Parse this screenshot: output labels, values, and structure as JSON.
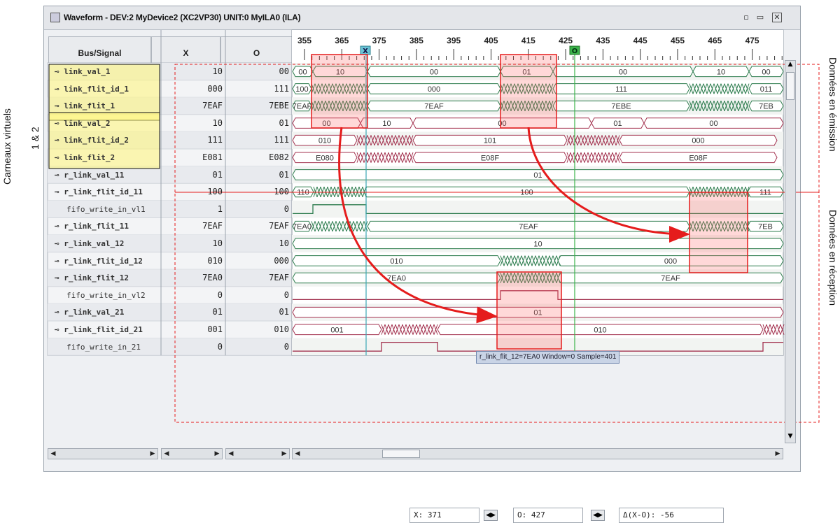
{
  "window": {
    "title": "Waveform - DEV:2 MyDevice2 (XC2VP30) UNIT:0 MyILA0 (ILA)"
  },
  "columns": {
    "bus_signal": "Bus/Signal",
    "x": "X",
    "o": "O"
  },
  "ruler": [
    "355",
    "365",
    "375",
    "385",
    "395",
    "405",
    "415",
    "425",
    "435",
    "445",
    "455",
    "465",
    "475"
  ],
  "cursors": {
    "x_label": "X",
    "o_label": "O"
  },
  "signals": [
    {
      "name": "link_val_1",
      "x": "10",
      "o": "00",
      "bold": true
    },
    {
      "name": "link_flit_id_1",
      "x": "000",
      "o": "111",
      "bold": true
    },
    {
      "name": "link_flit_1",
      "x": "7EAF",
      "o": "7EBE",
      "bold": true
    },
    {
      "name": "link_val_2",
      "x": "10",
      "o": "01",
      "bold": true
    },
    {
      "name": "link_flit_id_2",
      "x": "111",
      "o": "111",
      "bold": true
    },
    {
      "name": "link_flit_2",
      "x": "E081",
      "o": "E082",
      "bold": true
    },
    {
      "name": "r_link_val_11",
      "x": "01",
      "o": "01",
      "bold": true
    },
    {
      "name": "r_link_flit_id_11",
      "x": "100",
      "o": "100",
      "bold": true
    },
    {
      "name": "fifo_write_in_vl1",
      "x": "1",
      "o": "0",
      "bold": false
    },
    {
      "name": "r_link_flit_11",
      "x": "7EAF",
      "o": "7EAF",
      "bold": true
    },
    {
      "name": "r_link_val_12",
      "x": "10",
      "o": "10",
      "bold": true
    },
    {
      "name": "r_link_flit_id_12",
      "x": "010",
      "o": "000",
      "bold": true
    },
    {
      "name": "r_link_flit_12",
      "x": "7EA0",
      "o": "7EAF",
      "bold": true
    },
    {
      "name": "fifo_write_in_vl2",
      "x": "0",
      "o": "0",
      "bold": false
    },
    {
      "name": "r_link_val_21",
      "x": "01",
      "o": "01",
      "bold": true
    },
    {
      "name": "r_link_flit_id_21",
      "x": "001",
      "o": "010",
      "bold": true
    },
    {
      "name": "fifo_write_in_21",
      "x": "0",
      "o": "0",
      "bold": false
    }
  ],
  "wave_labels": {
    "r0": [
      "00",
      "10",
      "00",
      "01",
      "00",
      "10",
      "00"
    ],
    "r1": [
      "100",
      "000",
      "111",
      "011"
    ],
    "r2": [
      "7EAF",
      "7EAF",
      "7EBE",
      "7EB"
    ],
    "r3": [
      "00",
      "10",
      "00",
      "01",
      "00"
    ],
    "r4": [
      "010",
      "101",
      "000"
    ],
    "r5": [
      "E080",
      "E08F",
      "E08F"
    ],
    "r6": [
      "01"
    ],
    "r7": [
      "110",
      "100",
      "111"
    ],
    "r9": [
      "7EA0",
      "7EAF",
      "7EB"
    ],
    "r10": [
      "10"
    ],
    "r11": [
      "010",
      "000"
    ],
    "r12": [
      "7EA0",
      "7EAF"
    ],
    "r14": [
      "01"
    ],
    "r15": [
      "001",
      "010"
    ]
  },
  "tooltip": "r_link_flit_12=7EA0  Window=0 Sample=401",
  "readouts": {
    "x_label": "X:",
    "x_value": "371",
    "o_label": "O:",
    "o_value": "427",
    "delta_label": "Δ(X-O):",
    "delta_value": "-56"
  },
  "annotations": {
    "left_line1": "Carneaux virtuels",
    "left_line2": "1 & 2",
    "right_top": "Données en émission",
    "right_bottom": "Données en réception"
  }
}
